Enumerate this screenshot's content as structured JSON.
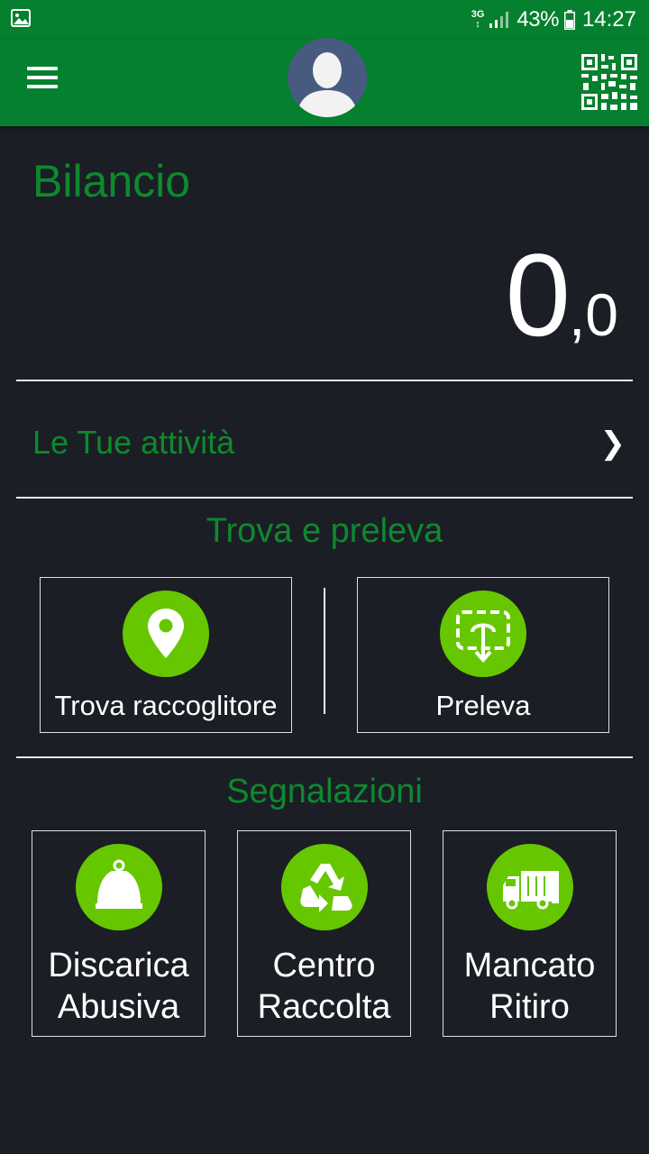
{
  "status_bar": {
    "network_type_top": "3G",
    "network_type_bottom": "↕",
    "battery_percent": "43%",
    "time": "14:27",
    "icons": [
      "gallery-notification-icon",
      "signal-icon",
      "battery-icon"
    ]
  },
  "app_bar": {
    "menu_icon": "hamburger-menu-icon",
    "avatar_icon": "user-avatar-icon",
    "qr_icon": "qr-code-icon"
  },
  "balance": {
    "title": "Bilancio",
    "integer_part": "0",
    "decimal_part": ",0"
  },
  "activities": {
    "label": "Le Tue attività",
    "chevron": "❯"
  },
  "find_section": {
    "title": "Trova e preleva",
    "tiles": [
      {
        "label": "Trova raccoglitore",
        "icon": "map-pin-icon"
      },
      {
        "label": "Preleva",
        "icon": "withdraw-touch-icon"
      }
    ]
  },
  "reports_section": {
    "title": "Segnalazioni",
    "tiles": [
      {
        "line1": "Discarica",
        "line2": "Abusiva",
        "icon": "garbage-bag-icon"
      },
      {
        "line1": "Centro",
        "line2": "Raccolta",
        "icon": "recycle-icon"
      },
      {
        "line1": "Mancato",
        "line2": "Ritiro",
        "icon": "garbage-truck-icon"
      }
    ]
  },
  "colors": {
    "brand_green": "#05802e",
    "text_green": "#0d8a2e",
    "icon_green": "#66c700",
    "background": "#1c1e26"
  }
}
